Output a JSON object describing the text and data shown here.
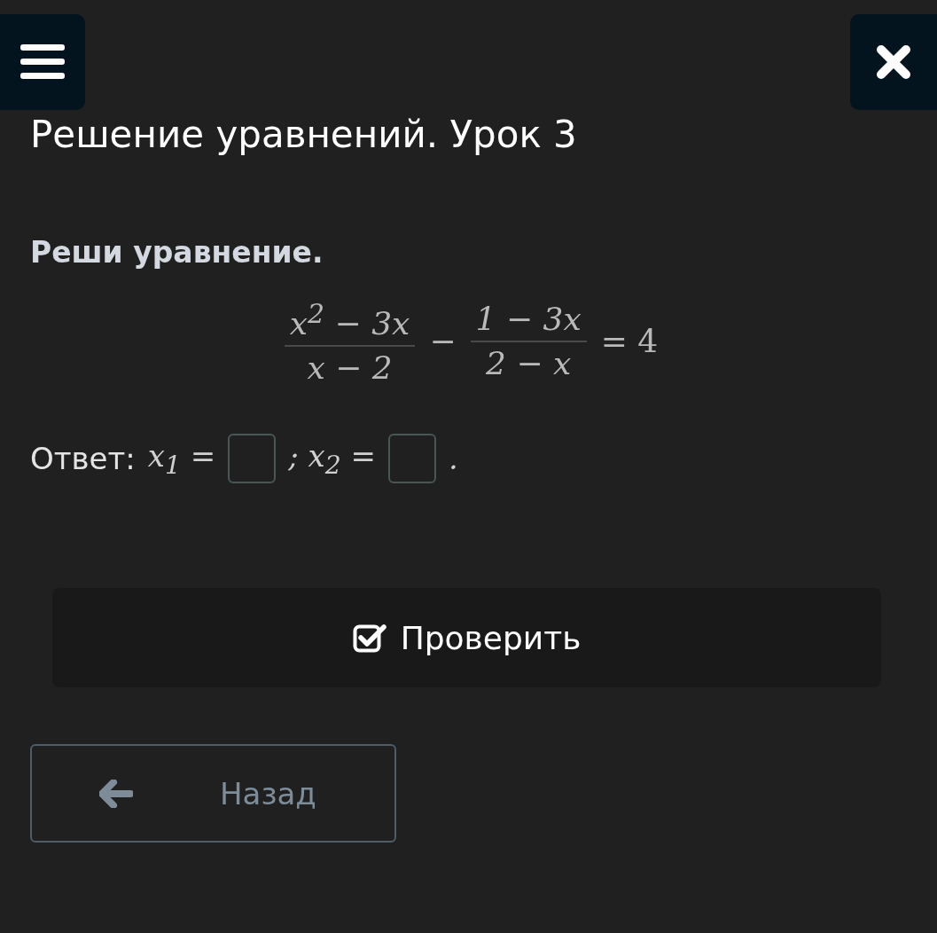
{
  "header": {
    "title": "Решение уравнений. Урок 3"
  },
  "task": {
    "prompt": "Реши уравнение.",
    "equation": [
      {
        "kind": "fraction",
        "numerator": "x$^{2}$ − 3x",
        "denominator": "x − 2"
      },
      {
        "kind": "operator",
        "text": "−"
      },
      {
        "kind": "fraction",
        "numerator": "1 − 3x",
        "denominator": "2 − x"
      },
      {
        "kind": "operator",
        "text": "= 4"
      }
    ],
    "answer": {
      "label": "Ответ:",
      "parts": [
        {
          "kind": "text",
          "text": "x$_{1}$ ="
        },
        {
          "kind": "field"
        },
        {
          "kind": "text",
          "text": "; x$_{2}$ ="
        },
        {
          "kind": "field"
        },
        {
          "kind": "text",
          "text": "."
        }
      ]
    }
  },
  "check_button": {
    "label": "Проверить"
  },
  "back_button": {
    "label": "Назад"
  }
}
